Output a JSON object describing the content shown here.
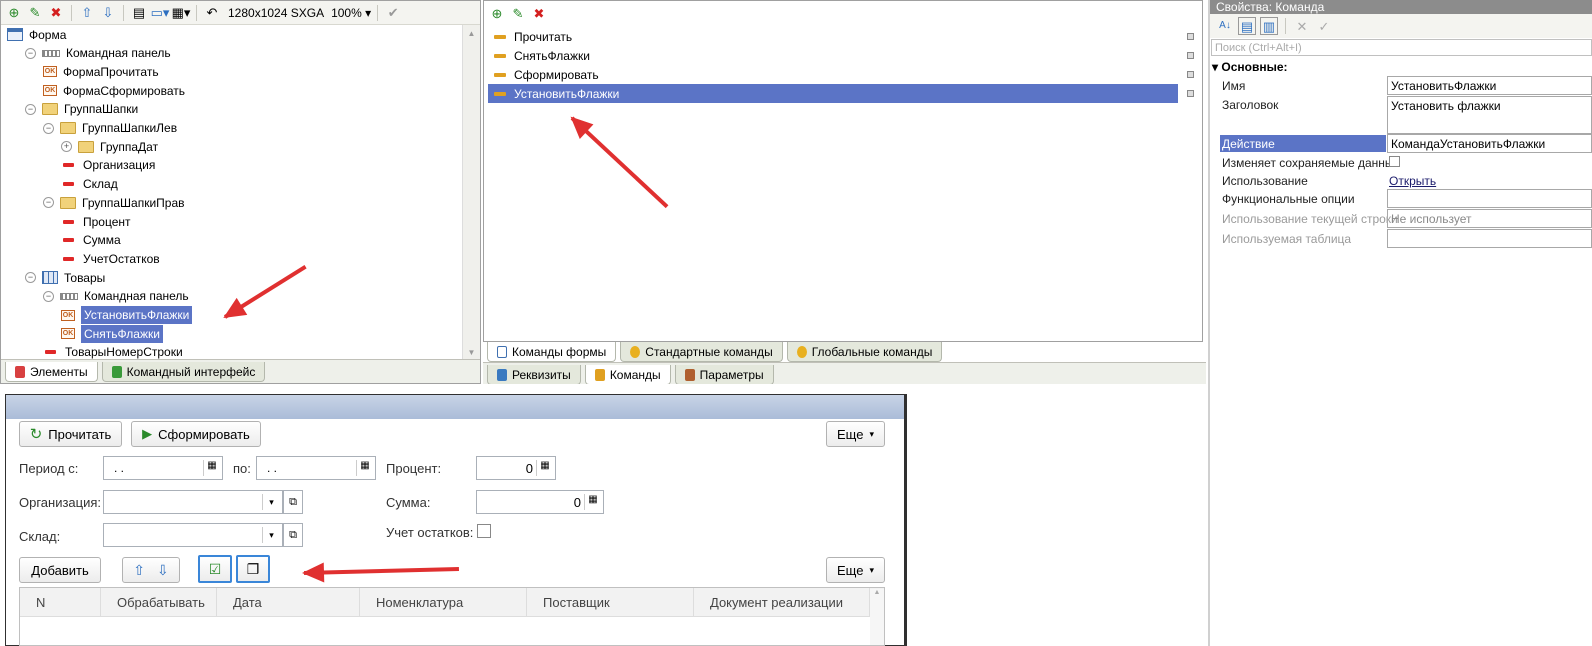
{
  "left_tree": {
    "toolbar": {
      "resolution": "1280x1024 SXGA",
      "zoom": "100%"
    },
    "items": [
      {
        "label": "Форма",
        "icon": "form-icon",
        "indent": 0,
        "exp": ""
      },
      {
        "label": "Командная панель",
        "icon": "command-panel-icon",
        "indent": 1,
        "exp": "⊖"
      },
      {
        "label": "ФормаПрочитать",
        "icon": "ok-button-icon",
        "indent": 2,
        "exp": ""
      },
      {
        "label": "ФормаСформировать",
        "icon": "ok-button-icon",
        "indent": 2,
        "exp": ""
      },
      {
        "label": "ГруппаШапки",
        "icon": "folder-icon",
        "indent": 1,
        "exp": "⊖"
      },
      {
        "label": "ГруппаШапкиЛев",
        "icon": "folder-icon",
        "indent": 2,
        "exp": "⊖"
      },
      {
        "label": "ГруппаДат",
        "icon": "folder-icon",
        "indent": 3,
        "exp": "⊕"
      },
      {
        "label": "Организация",
        "icon": "field-icon",
        "indent": 3,
        "exp": ""
      },
      {
        "label": "Склад",
        "icon": "field-icon",
        "indent": 3,
        "exp": ""
      },
      {
        "label": "ГруппаШапкиПрав",
        "icon": "folder-icon",
        "indent": 2,
        "exp": "⊖"
      },
      {
        "label": "Процент",
        "icon": "field-icon",
        "indent": 3,
        "exp": ""
      },
      {
        "label": "Сумма",
        "icon": "field-icon",
        "indent": 3,
        "exp": ""
      },
      {
        "label": "УчетОстатков",
        "icon": "field-icon",
        "indent": 3,
        "exp": ""
      },
      {
        "label": "Товары",
        "icon": "table-icon",
        "indent": 1,
        "exp": "⊖"
      },
      {
        "label": "Командная панель",
        "icon": "command-panel-icon",
        "indent": 2,
        "exp": "⊖"
      },
      {
        "label": "УстановитьФлажки",
        "icon": "ok-button-icon",
        "indent": 3,
        "exp": "",
        "selected": true
      },
      {
        "label": "СнятьФлажки",
        "icon": "ok-button-icon",
        "indent": 3,
        "exp": "",
        "selected": true
      },
      {
        "label": "ТоварыНомерСтроки",
        "icon": "field-icon",
        "indent": 2,
        "exp": ""
      }
    ],
    "tabs": [
      "Элементы",
      "Командный интерфейс"
    ]
  },
  "commands_pane": {
    "items": [
      "Прочитать",
      "СнятьФлажки",
      "Сформировать",
      "УстановитьФлажки"
    ],
    "selected_index": 3,
    "inner_tabs": [
      "Команды формы",
      "Стандартные команды",
      "Глобальные команды"
    ],
    "outer_tabs": [
      "Реквизиты",
      "Команды",
      "Параметры"
    ]
  },
  "properties": {
    "title": "Свойства: Команда",
    "search_placeholder": "Поиск (Ctrl+Alt+I)",
    "section": "Основные:",
    "rows": {
      "name_label": "Имя",
      "name_value": "УстановитьФлажки",
      "caption_label": "Заголовок",
      "caption_value": "Установить флажки",
      "action_label": "Действие",
      "action_value": "КомандаУстановитьФлажки",
      "modifies_label": "Изменяет сохраняемые данные",
      "usage_label": "Использование",
      "usage_value": "Открыть",
      "functional_label": "Функциональные опции",
      "current_row_label": "Использование текущей строки",
      "current_row_value": "Не использует",
      "table_label": "Используемая таблица"
    }
  },
  "preview": {
    "read_btn": "Прочитать",
    "build_btn": "Сформировать",
    "more_btn": "Еще",
    "period_label": "Период с:",
    "period_from": " .  .",
    "to_label": "по:",
    "period_to": " .  .",
    "percent_label": "Процент:",
    "percent_value": "0",
    "org_label": "Организация:",
    "sum_label": "Сумма:",
    "sum_value": "0",
    "warehouse_label": "Склад:",
    "stock_label": "Учет остатков:",
    "add_btn": "Добавить",
    "more_btn2": "Еще",
    "columns": [
      "N",
      "Обрабатывать",
      "Дата",
      "Номенклатура",
      "Поставщик",
      "Документ реализации"
    ]
  }
}
